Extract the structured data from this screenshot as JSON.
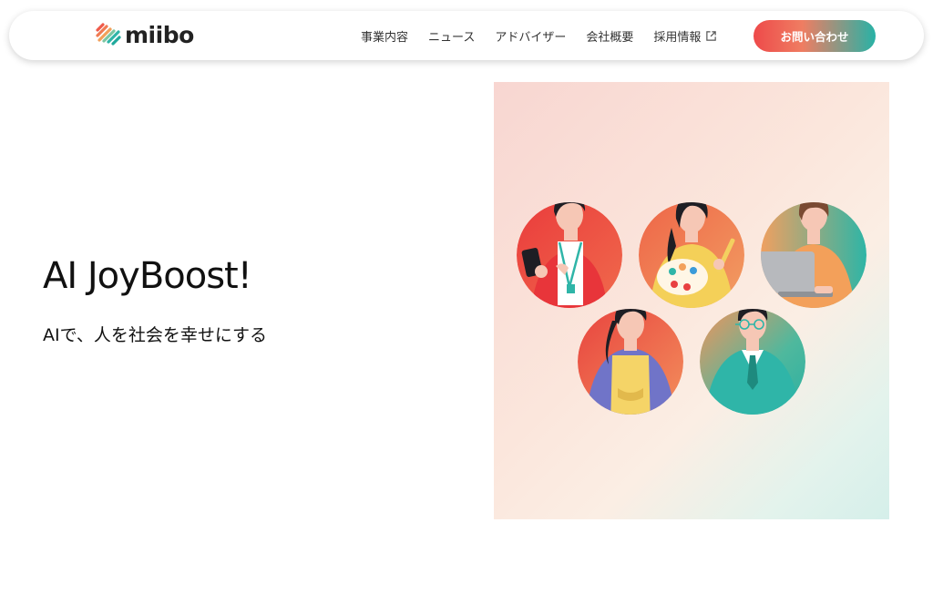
{
  "header": {
    "logo_text": "miibo",
    "nav": [
      {
        "label": "事業内容"
      },
      {
        "label": "ニュース"
      },
      {
        "label": "アドバイザー"
      },
      {
        "label": "会社概要"
      },
      {
        "label": "採用情報",
        "icon": "external-link-icon"
      }
    ],
    "contact_label": "お問い合わせ"
  },
  "hero": {
    "title": "AI JoyBoost!",
    "subtitle": "AIで、人を社会を幸せにする"
  },
  "colors": {
    "brand_red": "#ee4a4a",
    "brand_orange": "#ef7d62",
    "brand_teal": "#28b2a6",
    "text_dark": "#111111"
  }
}
